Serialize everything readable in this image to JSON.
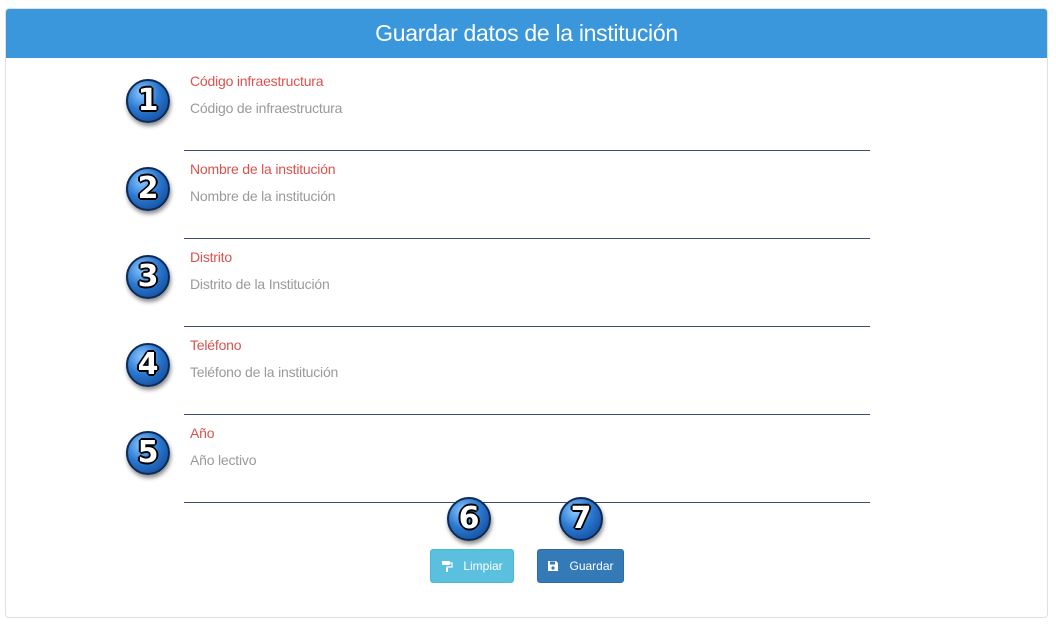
{
  "header": {
    "title": "Guardar datos de la institución"
  },
  "form": {
    "fields": [
      {
        "label": "Código infraestructura",
        "placeholder": "Código de infraestructura",
        "value": ""
      },
      {
        "label": "Nombre de la institución",
        "placeholder": "Nombre de la institución",
        "value": ""
      },
      {
        "label": "Distrito",
        "placeholder": "Distrito de la Institución",
        "value": ""
      },
      {
        "label": "Teléfono",
        "placeholder": "Teléfono de la institución",
        "value": ""
      },
      {
        "label": "Año",
        "placeholder": "Año lectivo",
        "value": ""
      }
    ]
  },
  "annotations": [
    "1",
    "2",
    "3",
    "4",
    "5",
    "6",
    "7"
  ],
  "buttons": {
    "clear": {
      "label": "Limpiar",
      "icon": "paint-roller-icon"
    },
    "save": {
      "label": "Guardar",
      "icon": "floppy-disk-icon"
    }
  },
  "colors": {
    "header": "#3a97dc",
    "label": "#d9534f",
    "clear_button": "#5bc0de",
    "save_button": "#337ab7"
  }
}
